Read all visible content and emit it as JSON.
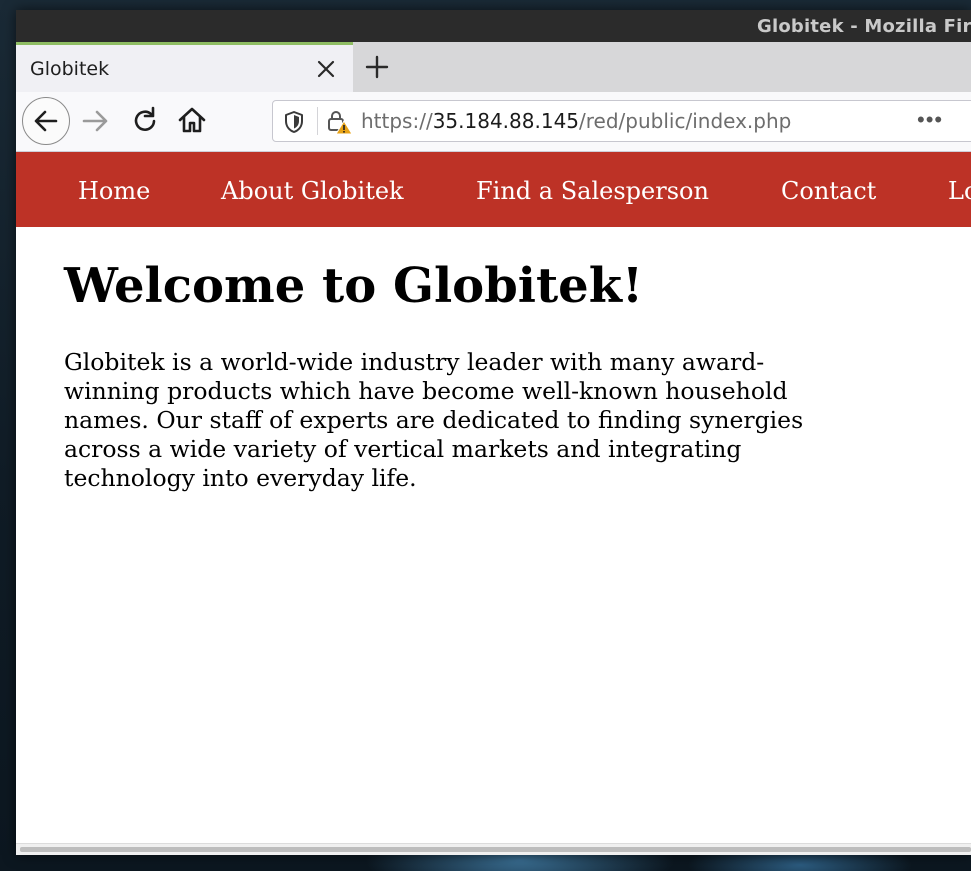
{
  "window": {
    "title": "Globitek - Mozilla Firefox"
  },
  "tabs": [
    {
      "label": "Globitek",
      "active": true
    }
  ],
  "toolbar": {
    "url_scheme": "https://",
    "url_host": "35.184.88.145",
    "url_path": "/red/public/index.php",
    "more_label": "•••"
  },
  "site": {
    "nav": [
      {
        "label": "Home"
      },
      {
        "label": "About Globitek"
      },
      {
        "label": "Find a Salesperson"
      },
      {
        "label": "Contact"
      },
      {
        "label": "Login"
      }
    ],
    "heading": "Welcome to Globitek!",
    "intro": "Globitek is a world-wide industry leader with many award-winning products which have become well-known household names. Our staff of experts are dedicated to finding synergies across a wide variety of vertical markets and integrating technology into everyday life."
  },
  "colors": {
    "nav_background": "#bd3226",
    "tab_accent": "#8fbd63",
    "warning": "#e8a317"
  },
  "icons": [
    "close-icon",
    "plus-icon",
    "back-arrow-icon",
    "forward-arrow-icon",
    "reload-icon",
    "home-icon",
    "shield-icon",
    "lock-warning-icon",
    "ellipsis-icon"
  ]
}
